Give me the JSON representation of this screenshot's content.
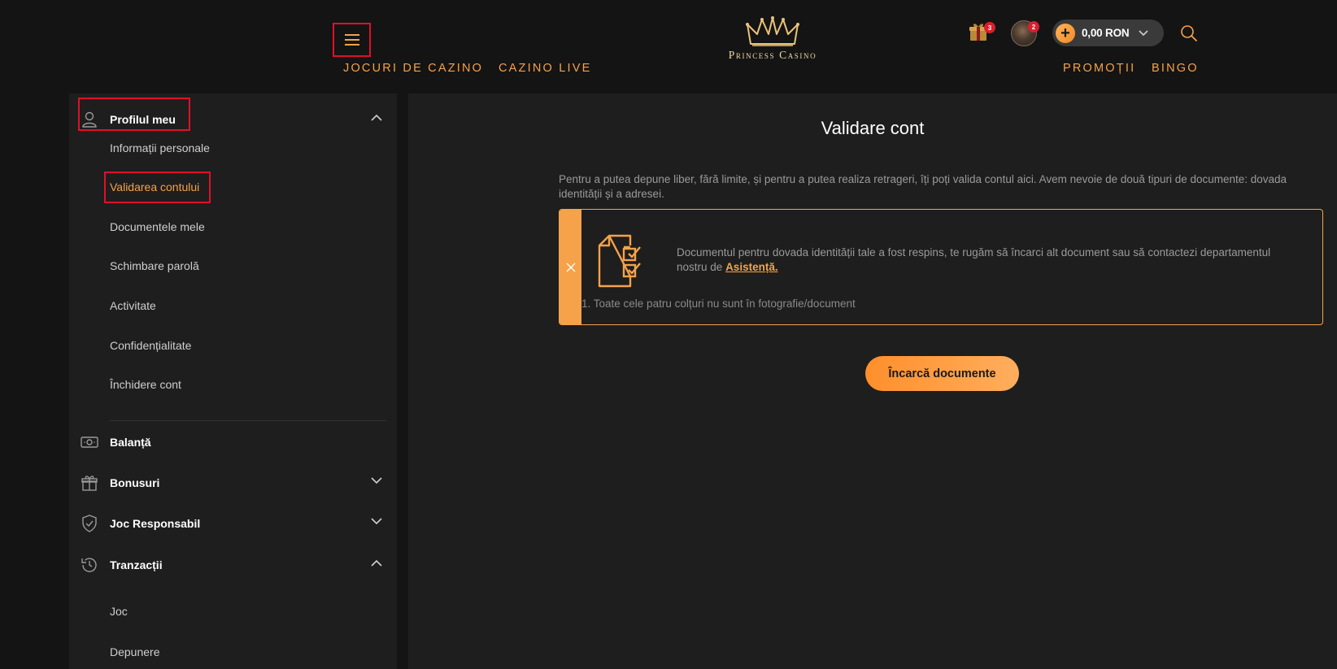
{
  "header": {
    "menu_icon": "hamburger-icon",
    "nav_left": [
      "JOCURI DE CAZINO",
      "CAZINO LIVE"
    ],
    "nav_right": [
      "PROMOȚII",
      "BINGO"
    ],
    "logo_text": "Princess Casino",
    "gift_badge": "3",
    "avatar_badge": "2",
    "balance": "0,00 RON",
    "accent_color": "#f5a24a"
  },
  "sidebar": {
    "profile": {
      "label": "Profilul meu",
      "items": [
        "Informații personale",
        "Validarea contului",
        "Documentele mele",
        "Schimbare parolă",
        "Activitate",
        "Confidențialitate",
        "Închidere cont"
      ],
      "active_index": 1
    },
    "balance_label": "Balanță",
    "bonuses_label": "Bonusuri",
    "responsible_label": "Joc Responsabil",
    "transactions": {
      "label": "Tranzacții",
      "items": [
        "Joc",
        "Depunere"
      ]
    }
  },
  "main": {
    "title": "Validare cont",
    "intro": "Pentru a putea depune liber, fără limite, și pentru a putea realiza retrageri, îți poți valida contul aici. Avem nevoie de două tipuri de documente: dovada identității și a adresei.",
    "alert": {
      "message": "Documentul pentru dovada identității tale a fost respins, te rugăm să încarci alt document sau să contactezi departamentul nostru de",
      "link": "Asistență.",
      "reason": "1. Toate cele patru colțuri nu sunt în fotografie/document"
    },
    "upload_button": "Încarcă documente"
  }
}
